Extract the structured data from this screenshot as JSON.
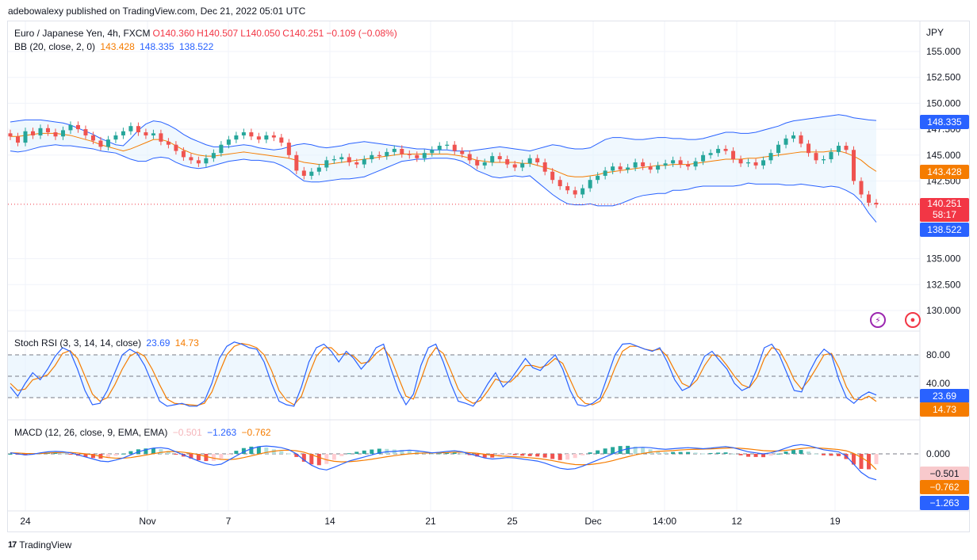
{
  "publisher_line": "adebowalexy published on TradingView.com, Dec 21, 2022 05:01 UTC",
  "footer_brand": "TradingView",
  "colors": {
    "up": "#26a69a",
    "down": "#ef5350",
    "bb_basis": "#f57c00",
    "bb_band": "#2962ff",
    "stoch_k": "#2962ff",
    "stoch_d": "#f57c00",
    "macd": "#2962ff",
    "signal": "#f57c00",
    "price_line": "#f23645"
  },
  "main_legend": {
    "symbol": "Euro / Japanese Yen, 4h, FXCM",
    "o": "O140.360",
    "h": "H140.507",
    "l": "L140.050",
    "c": "C140.251",
    "change": "−0.109 (−0.08%)",
    "bb_label": "BB (20, close, 2, 0)",
    "bb_basis": "143.428",
    "bb_upper": "148.335",
    "bb_lower": "138.522"
  },
  "stoch_legend": {
    "label": "Stoch RSI (3, 3, 14, 14, close)",
    "k": "23.69",
    "d": "14.73"
  },
  "macd_legend": {
    "label": "MACD (12, 26, close, 9, EMA, EMA)",
    "hist": "−0.501",
    "macd": "−1.263",
    "signal": "−0.762"
  },
  "price_axis": {
    "currency": "JPY",
    "ticks": [
      "155.000",
      "152.500",
      "150.000",
      "147.500",
      "145.000",
      "142.500",
      "135.000",
      "132.500",
      "130.000"
    ]
  },
  "price_tags": {
    "upper": "148.335",
    "basis": "143.428",
    "last": "140.251",
    "countdown": "58:17",
    "lower": "138.522"
  },
  "stoch_axis": {
    "ticks": [
      "80.00",
      "40.00"
    ],
    "k_tag": "23.69",
    "d_tag": "14.73"
  },
  "macd_axis": {
    "ticks": [
      "0.000"
    ],
    "hist_tag": "−0.501",
    "signal_tag": "−0.762",
    "macd_tag": "−1.263"
  },
  "time_axis": [
    "24",
    "Nov",
    "7",
    "14",
    "21",
    "25",
    "Dec",
    "14:00",
    "12",
    "19"
  ],
  "icons": {
    "alert": "lightning-icon",
    "record": "record-icon"
  },
  "chart_data": [
    {
      "type": "candlestick",
      "title": "Euro / Japanese Yen, 4h, FXCM",
      "ylabel": "JPY",
      "ylim": [
        128.5,
        157.5
      ],
      "close_series": [
        146.8,
        146.2,
        147.3,
        146.9,
        147.6,
        147.2,
        146.8,
        147.4,
        147.9,
        147.5,
        146.9,
        146.4,
        145.8,
        146.5,
        146.9,
        147.3,
        147.8,
        147.2,
        146.9,
        147.1,
        146.3,
        146.0,
        145.4,
        144.8,
        144.5,
        144.2,
        144.7,
        145.2,
        146.0,
        146.5,
        146.9,
        147.2,
        146.8,
        146.5,
        146.9,
        146.7,
        146.2,
        145.0,
        143.5,
        143.0,
        143.4,
        143.8,
        144.5,
        144.6,
        144.8,
        144.3,
        144.1,
        144.6,
        145.0,
        144.9,
        145.3,
        145.6,
        145.1,
        145.0,
        144.7,
        145.2,
        145.5,
        145.9,
        146.0,
        145.4,
        145.1,
        144.5,
        144.0,
        144.3,
        144.9,
        144.6,
        144.1,
        143.8,
        144.2,
        144.7,
        144.3,
        143.4,
        142.6,
        142.0,
        141.6,
        141.2,
        141.8,
        142.6,
        143.0,
        143.5,
        143.9,
        143.6,
        143.8,
        144.3,
        143.9,
        143.6,
        144.0,
        144.2,
        144.5,
        144.1,
        143.9,
        144.4,
        145.0,
        145.2,
        145.6,
        145.4,
        144.6,
        144.2,
        144.3,
        144.0,
        144.5,
        145.2,
        146.0,
        146.6,
        146.9,
        146.1,
        145.2,
        144.5,
        144.6,
        145.3,
        145.9,
        145.5,
        142.5,
        141.2,
        140.4,
        140.251
      ],
      "bb_basis": [
        146.8,
        146.8,
        146.9,
        147.0,
        147.1,
        147.1,
        147.1,
        147.0,
        146.9,
        146.7,
        146.5,
        146.3,
        146.0,
        145.8,
        145.6,
        145.4,
        145.6,
        145.9,
        146.2,
        146.5,
        146.5,
        146.3,
        145.9,
        145.5,
        145.2,
        145.0,
        144.9,
        144.9,
        145.0,
        145.1,
        145.2,
        145.3,
        145.2,
        145.1,
        145.0,
        144.9,
        144.8,
        144.7,
        144.5,
        144.3,
        144.2,
        144.1,
        144.1,
        144.2,
        144.3,
        144.4,
        144.5,
        144.6,
        144.7,
        144.8,
        144.9,
        145.0,
        145.1,
        145.1,
        145.1,
        145.1,
        145.1,
        145.1,
        145.1,
        145.0,
        144.9,
        144.7,
        144.5,
        144.4,
        144.3,
        144.3,
        144.3,
        144.3,
        144.2,
        144.2,
        144.0,
        143.8,
        143.6,
        143.3,
        143.0,
        142.9,
        142.9,
        143.0,
        143.1,
        143.3,
        143.4,
        143.5,
        143.6,
        143.7,
        143.8,
        143.9,
        144.0,
        144.0,
        144.1,
        144.1,
        144.1,
        144.2,
        144.3,
        144.4,
        144.5,
        144.6,
        144.6,
        144.6,
        144.7,
        144.7,
        144.8,
        144.9,
        145.0,
        145.1,
        145.2,
        145.3,
        145.3,
        145.3,
        145.3,
        145.4,
        145.4,
        145.2,
        144.9,
        144.5,
        143.9,
        143.428
      ],
      "bb_upper": [
        148.2,
        148.3,
        148.4,
        148.4,
        148.4,
        148.3,
        148.2,
        148.1,
        147.9,
        147.6,
        147.3,
        147.0,
        146.6,
        146.3,
        146.0,
        145.9,
        146.6,
        147.4,
        148.0,
        148.3,
        148.2,
        147.9,
        147.5,
        147.0,
        146.6,
        146.3,
        146.0,
        145.8,
        145.8,
        145.8,
        145.9,
        146.0,
        145.9,
        145.7,
        145.6,
        145.5,
        145.6,
        145.8,
        146.0,
        146.1,
        146.0,
        145.8,
        145.7,
        145.8,
        145.9,
        146.1,
        146.2,
        146.3,
        146.2,
        146.1,
        146.0,
        145.9,
        145.8,
        145.7,
        145.6,
        145.6,
        145.5,
        145.5,
        145.5,
        145.4,
        145.4,
        145.4,
        145.5,
        145.6,
        145.7,
        145.8,
        145.7,
        145.6,
        145.5,
        145.4,
        145.6,
        145.8,
        146.0,
        145.9,
        145.7,
        145.6,
        145.6,
        145.7,
        146.1,
        146.5,
        146.7,
        146.7,
        146.6,
        146.5,
        146.5,
        146.6,
        146.7,
        146.7,
        146.6,
        146.6,
        146.5,
        146.5,
        146.6,
        146.8,
        147.0,
        147.2,
        147.2,
        147.1,
        147.1,
        147.2,
        147.4,
        147.6,
        147.8,
        148.1,
        148.3,
        148.4,
        148.5,
        148.6,
        148.7,
        148.8,
        148.9,
        148.8,
        148.6,
        148.5,
        148.4,
        148.335
      ],
      "bb_lower": [
        145.4,
        145.3,
        145.4,
        145.6,
        145.8,
        145.9,
        146.0,
        145.9,
        145.9,
        145.8,
        145.7,
        145.6,
        145.4,
        145.3,
        145.2,
        144.9,
        144.6,
        144.4,
        144.4,
        144.7,
        144.8,
        144.7,
        144.3,
        144.0,
        143.8,
        143.7,
        143.8,
        144.0,
        144.2,
        144.4,
        144.5,
        144.6,
        144.5,
        144.5,
        144.4,
        144.3,
        144.0,
        143.6,
        143.0,
        142.5,
        142.4,
        142.4,
        142.5,
        142.6,
        142.7,
        142.7,
        142.8,
        142.9,
        143.2,
        143.5,
        143.8,
        144.1,
        144.4,
        144.5,
        144.6,
        144.6,
        144.7,
        144.7,
        144.7,
        144.6,
        144.4,
        144.0,
        143.5,
        143.2,
        142.9,
        142.8,
        142.9,
        143.0,
        142.9,
        143.0,
        142.4,
        141.8,
        141.2,
        140.7,
        140.3,
        140.2,
        140.2,
        140.3,
        140.1,
        140.1,
        140.1,
        140.3,
        140.6,
        140.9,
        141.1,
        141.2,
        141.3,
        141.3,
        141.6,
        141.6,
        141.7,
        141.9,
        142.0,
        142.0,
        142.0,
        142.0,
        142.0,
        142.1,
        142.3,
        142.2,
        142.2,
        142.2,
        142.2,
        142.1,
        142.1,
        142.2,
        142.1,
        142.0,
        141.9,
        142.0,
        141.9,
        141.6,
        141.2,
        140.5,
        139.4,
        138.522
      ],
      "last_price": 140.251
    },
    {
      "type": "line",
      "title": "Stoch RSI (3, 3, 14, 14, close)",
      "ylim": [
        0,
        100
      ],
      "levels": [
        80,
        50,
        20
      ],
      "series": [
        {
          "name": "K",
          "values": [
            35,
            22,
            40,
            55,
            45,
            60,
            78,
            90,
            85,
            60,
            30,
            10,
            12,
            30,
            55,
            80,
            88,
            82,
            65,
            40,
            15,
            8,
            10,
            12,
            8,
            8,
            15,
            40,
            75,
            92,
            98,
            95,
            90,
            88,
            70,
            40,
            15,
            10,
            8,
            35,
            70,
            90,
            95,
            85,
            70,
            85,
            75,
            60,
            72,
            90,
            95,
            60,
            30,
            10,
            25,
            65,
            90,
            95,
            70,
            40,
            15,
            12,
            8,
            22,
            40,
            55,
            35,
            45,
            60,
            75,
            62,
            58,
            70,
            80,
            60,
            30,
            10,
            8,
            12,
            20,
            50,
            80,
            95,
            96,
            92,
            88,
            85,
            90,
            70,
            45,
            30,
            35,
            55,
            78,
            85,
            72,
            60,
            40,
            30,
            35,
            60,
            90,
            95,
            80,
            55,
            30,
            28,
            55,
            75,
            88,
            80,
            45,
            20,
            12,
            22,
            28,
            23.69
          ]
        },
        {
          "name": "D",
          "values": [
            40,
            30,
            32,
            45,
            48,
            52,
            65,
            82,
            86,
            75,
            50,
            25,
            15,
            20,
            38,
            60,
            78,
            84,
            78,
            60,
            38,
            18,
            12,
            11,
            10,
            9,
            12,
            28,
            55,
            80,
            92,
            96,
            94,
            90,
            80,
            58,
            30,
            16,
            10,
            22,
            52,
            78,
            90,
            90,
            80,
            82,
            78,
            68,
            70,
            82,
            90,
            75,
            48,
            22,
            18,
            45,
            75,
            90,
            82,
            58,
            32,
            18,
            12,
            16,
            30,
            46,
            42,
            42,
            52,
            65,
            65,
            62,
            66,
            75,
            68,
            45,
            22,
            12,
            10,
            15,
            35,
            62,
            85,
            92,
            92,
            88,
            86,
            88,
            78,
            58,
            40,
            35,
            45,
            65,
            80,
            78,
            65,
            50,
            38,
            34,
            48,
            75,
            90,
            87,
            68,
            45,
            32,
            45,
            62,
            80,
            82,
            62,
            35,
            18,
            17,
            22,
            14.73
          ]
        }
      ]
    },
    {
      "type": "line+bar",
      "title": "MACD (12, 26, close, 9, EMA, EMA)",
      "ylim": [
        -2.2,
        0.9
      ],
      "series": [
        {
          "name": "MACD",
          "values": [
            0.05,
            0.0,
            -0.05,
            -0.02,
            0.05,
            0.1,
            0.12,
            0.1,
            0.05,
            -0.05,
            -0.15,
            -0.25,
            -0.35,
            -0.38,
            -0.3,
            -0.2,
            -0.05,
            0.1,
            0.2,
            0.28,
            0.3,
            0.25,
            0.1,
            -0.05,
            -0.2,
            -0.35,
            -0.48,
            -0.55,
            -0.5,
            -0.3,
            -0.1,
            0.1,
            0.25,
            0.35,
            0.38,
            0.35,
            0.3,
            0.2,
            0.0,
            -0.3,
            -0.55,
            -0.72,
            -0.78,
            -0.65,
            -0.5,
            -0.35,
            -0.25,
            -0.15,
            -0.05,
            0.05,
            0.1,
            0.12,
            0.15,
            0.18,
            0.15,
            0.1,
            0.05,
            0.08,
            0.12,
            0.15,
            0.1,
            0.0,
            -0.1,
            -0.2,
            -0.25,
            -0.22,
            -0.18,
            -0.2,
            -0.25,
            -0.3,
            -0.35,
            -0.45,
            -0.58,
            -0.7,
            -0.75,
            -0.72,
            -0.6,
            -0.45,
            -0.3,
            -0.15,
            0.0,
            0.15,
            0.25,
            0.3,
            0.32,
            0.3,
            0.25,
            0.22,
            0.25,
            0.28,
            0.3,
            0.28,
            0.25,
            0.28,
            0.32,
            0.35,
            0.3,
            0.2,
            0.1,
            0.05,
            0.0,
            0.05,
            0.15,
            0.28,
            0.4,
            0.45,
            0.4,
            0.3,
            0.2,
            0.15,
            0.1,
            -0.1,
            -0.5,
            -0.9,
            -1.15,
            -1.263
          ]
        },
        {
          "name": "Signal",
          "values": [
            0.05,
            0.04,
            0.02,
            0.01,
            0.02,
            0.04,
            0.06,
            0.07,
            0.07,
            0.04,
            0.0,
            -0.05,
            -0.12,
            -0.18,
            -0.21,
            -0.21,
            -0.18,
            -0.12,
            -0.06,
            0.01,
            0.07,
            0.11,
            0.11,
            0.08,
            0.03,
            -0.04,
            -0.13,
            -0.21,
            -0.27,
            -0.28,
            -0.25,
            -0.18,
            -0.1,
            -0.01,
            0.07,
            0.13,
            0.17,
            0.18,
            0.15,
            0.08,
            -0.04,
            -0.17,
            -0.29,
            -0.36,
            -0.39,
            -0.38,
            -0.35,
            -0.31,
            -0.26,
            -0.2,
            -0.14,
            -0.09,
            -0.04,
            0.0,
            0.03,
            0.04,
            0.04,
            0.05,
            0.06,
            0.08,
            0.08,
            0.06,
            0.03,
            -0.02,
            -0.07,
            -0.1,
            -0.12,
            -0.14,
            -0.16,
            -0.19,
            -0.22,
            -0.27,
            -0.33,
            -0.4,
            -0.47,
            -0.52,
            -0.53,
            -0.52,
            -0.47,
            -0.41,
            -0.33,
            -0.23,
            -0.14,
            -0.05,
            0.02,
            0.08,
            0.12,
            0.14,
            0.16,
            0.19,
            0.21,
            0.22,
            0.23,
            0.24,
            0.26,
            0.28,
            0.29,
            0.27,
            0.24,
            0.2,
            0.16,
            0.14,
            0.14,
            0.17,
            0.21,
            0.26,
            0.29,
            0.29,
            0.27,
            0.24,
            0.21,
            0.15,
            0.02,
            -0.17,
            -0.4,
            -0.762
          ]
        },
        {
          "name": "Histogram",
          "values": [
            0.0,
            -0.04,
            -0.07,
            -0.03,
            0.03,
            0.06,
            0.06,
            0.03,
            -0.02,
            -0.09,
            -0.15,
            -0.2,
            -0.23,
            -0.2,
            -0.09,
            0.01,
            0.13,
            0.22,
            0.26,
            0.27,
            0.23,
            0.14,
            -0.01,
            -0.13,
            -0.23,
            -0.31,
            -0.35,
            -0.34,
            -0.23,
            -0.02,
            0.15,
            0.28,
            0.35,
            0.36,
            0.31,
            0.22,
            0.13,
            0.02,
            -0.15,
            -0.38,
            -0.51,
            -0.55,
            -0.49,
            -0.29,
            -0.11,
            0.03,
            0.1,
            0.16,
            0.21,
            0.25,
            0.24,
            0.21,
            0.19,
            0.18,
            0.12,
            0.06,
            0.01,
            0.03,
            0.06,
            0.07,
            0.02,
            -0.06,
            -0.13,
            -0.18,
            -0.18,
            -0.12,
            -0.06,
            -0.06,
            -0.09,
            -0.11,
            -0.13,
            -0.18,
            -0.25,
            -0.3,
            -0.28,
            -0.2,
            -0.07,
            0.07,
            0.17,
            0.26,
            0.33,
            0.38,
            0.39,
            0.35,
            0.3,
            0.22,
            0.13,
            0.08,
            0.09,
            0.09,
            0.09,
            0.06,
            0.02,
            0.04,
            0.06,
            0.07,
            0.01,
            -0.07,
            -0.14,
            -0.15,
            -0.16,
            -0.09,
            0.01,
            0.11,
            0.19,
            0.19,
            0.11,
            0.01,
            -0.07,
            -0.09,
            -0.11,
            -0.25,
            -0.52,
            -0.73,
            -0.75,
            -0.501
          ]
        }
      ]
    }
  ]
}
